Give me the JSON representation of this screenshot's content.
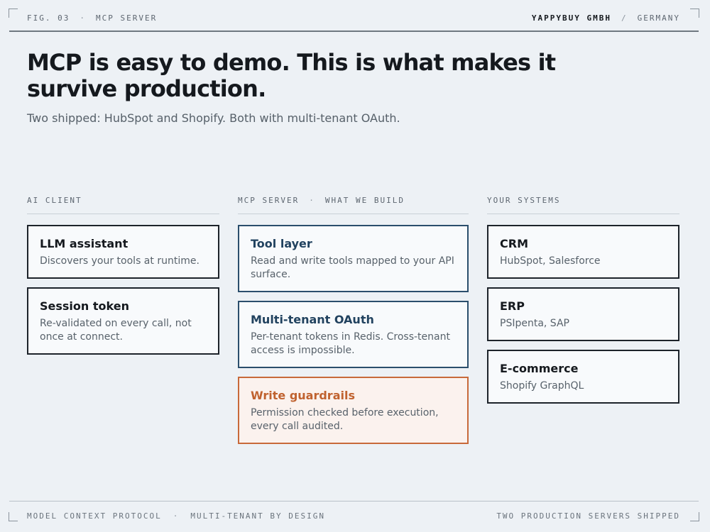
{
  "header": {
    "fig_label": "FIG. 03",
    "separator": "·",
    "section": "MCP SERVER",
    "company": "YAPPYBUY GMBH",
    "slash": "/",
    "country": "GERMANY"
  },
  "title": "MCP is easy to demo. This is what makes it survive production.",
  "subtitle": "Two shipped: HubSpot and Shopify. Both with multi-tenant OAuth.",
  "columns": [
    {
      "heading": "AI CLIENT",
      "cards": [
        {
          "title": "LLM assistant",
          "desc": "Discovers your tools at runtime."
        },
        {
          "title": "Session token",
          "desc": "Re-validated on every call, not once at connect."
        }
      ]
    },
    {
      "heading": "MCP SERVER",
      "heading_sep": "·",
      "heading_sub": "WHAT WE BUILD",
      "cards": [
        {
          "title": "Tool layer",
          "desc": "Read and write tools mapped to your API surface."
        },
        {
          "title": "Multi-tenant OAuth",
          "desc": "Per-tenant tokens in Redis. Cross-tenant access is impossible."
        },
        {
          "title": "Write guardrails",
          "desc": "Permission checked before execution, every call audited."
        }
      ]
    },
    {
      "heading": "YOUR SYSTEMS",
      "cards": [
        {
          "title": "CRM",
          "desc": "HubSpot, Salesforce"
        },
        {
          "title": "ERP",
          "desc": "PSIpenta, SAP"
        },
        {
          "title": "E-commerce",
          "desc": "Shopify GraphQL"
        }
      ]
    }
  ],
  "footer": {
    "left": "MODEL CONTEXT PROTOCOL",
    "separator": "·",
    "middle": "MULTI-TENANT BY DESIGN",
    "right": "TWO PRODUCTION SERVERS SHIPPED"
  },
  "colors": {
    "background": "#edf1f5",
    "text": "#15191e",
    "accent_blue": "#2b4e6c",
    "accent_orange": "#c8693a"
  }
}
